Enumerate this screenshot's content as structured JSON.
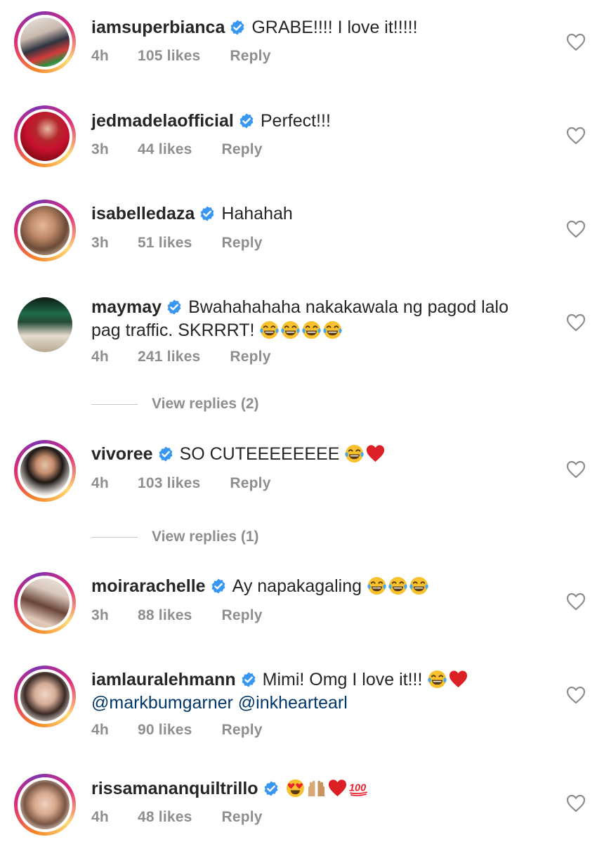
{
  "comments": [
    {
      "username": "iamsuperbianca",
      "text": "GRABE!!!! I love it!!!!!",
      "emoji": [],
      "time": "4h",
      "likes": "105 likes",
      "reply": "Reply"
    },
    {
      "username": "jedmadelaofficial",
      "text": "Perfect!!!",
      "emoji": [],
      "time": "3h",
      "likes": "44 likes",
      "reply": "Reply"
    },
    {
      "username": "isabelledaza",
      "text": "Hahahah",
      "emoji": [],
      "time": "3h",
      "likes": "51 likes",
      "reply": "Reply"
    },
    {
      "username": "maymay",
      "text": "Bwahahahaha nakakawala ng pagod lalo pag traffic. SKRRRT!",
      "emoji": [
        "laughing-crying",
        "laughing-crying",
        "laughing-crying",
        "laughing-crying"
      ],
      "time": "4h",
      "likes": "241 likes",
      "reply": "Reply",
      "view_replies": "View replies (2)"
    },
    {
      "username": "vivoree",
      "text": "SO CUTEEEEEEEE",
      "emoji": [
        "laughing-crying",
        "red-heart"
      ],
      "time": "4h",
      "likes": "103 likes",
      "reply": "Reply",
      "view_replies": "View replies (1)"
    },
    {
      "username": "moirarachelle",
      "text": "Ay napakagaling",
      "emoji": [
        "laughing-crying",
        "laughing-crying",
        "laughing-crying"
      ],
      "time": "3h",
      "likes": "88 likes",
      "reply": "Reply"
    },
    {
      "username": "iamlauralehmann",
      "text": "Mimi! Omg I love it!!!",
      "emoji": [
        "laughing-crying",
        "red-heart"
      ],
      "mentions": "@markbumgarner @inkheartearl",
      "time": "4h",
      "likes": "90 likes",
      "reply": "Reply"
    },
    {
      "username": "rissamananquiltrillo",
      "text": "",
      "emoji": [
        "heart-eyes",
        "raised-hands",
        "red-heart",
        "hundred-points"
      ],
      "time": "4h",
      "likes": "48 likes",
      "reply": "Reply"
    }
  ],
  "colors": {
    "username": "#262626",
    "meta": "#8e8e8e",
    "verified": "#3897f0",
    "mention": "#00376b",
    "heart_outline": "#8e8e8e"
  }
}
